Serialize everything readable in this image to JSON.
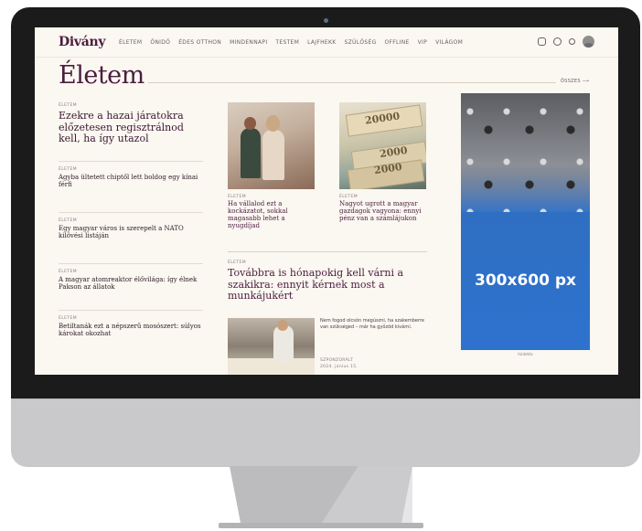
{
  "site": {
    "logo": "Divány",
    "nav": [
      "ÉLETEM",
      "ÖNIDŐ",
      "ÉDES OTTHON",
      "MINDENNAPI",
      "TESTEM",
      "LAJFHEKK",
      "SZÜLŐSÉG",
      "OFFLINE",
      "VIP",
      "VILÁGOM"
    ]
  },
  "section": {
    "title": "Életem",
    "all_link": "ÖSSZES ⟶"
  },
  "left_column": {
    "lead": {
      "kicker": "ÉLETEM",
      "headline": "Ezekre a hazai járatokra előzetesen regisztrálnod kell, ha így utazol"
    },
    "items": [
      {
        "kicker": "ÉLETEM",
        "headline": "Agyba ültetett chiptől lett boldog egy kínai férfi"
      },
      {
        "kicker": "ÉLETEM",
        "headline": "Egy magyar város is szerepelt a NATO kilövési listáján"
      },
      {
        "kicker": "ÉLETEM",
        "headline": "A magyar atomreaktor élővilága: így élnek Pakson az állatok"
      },
      {
        "kicker": "ÉLETEM",
        "headline": "Betiltanák ezt a népszerű mosószert: súlyos károkat okozhat"
      }
    ]
  },
  "cards": [
    {
      "kicker": "ÉLETEM",
      "headline": "Ha vállalod ezt a kockázatot, sokkal magasabb lehet a nyugdíjad"
    },
    {
      "kicker": "ÉLETEM",
      "headline": "Nagyot ugrott a magyar gazdagok vagyona: ennyi pénz van a számlájukon"
    }
  ],
  "money_notes": [
    "20000",
    "2000",
    "2000"
  ],
  "feature": {
    "kicker": "ÉLETEM",
    "headline": "Továbbra is hónapokig kell várni a szakikra: ennyit kérnek most a munkájukért",
    "description": "Nem fogod olcsón megúszni, ha szakemberre van szükséged – már ha győzöd kivárni.",
    "meta_kicker": "SZPONZORÁLT",
    "meta_date": "2024. június 15."
  },
  "ad": {
    "label": "300x600 px",
    "caption": "hirdetés"
  }
}
